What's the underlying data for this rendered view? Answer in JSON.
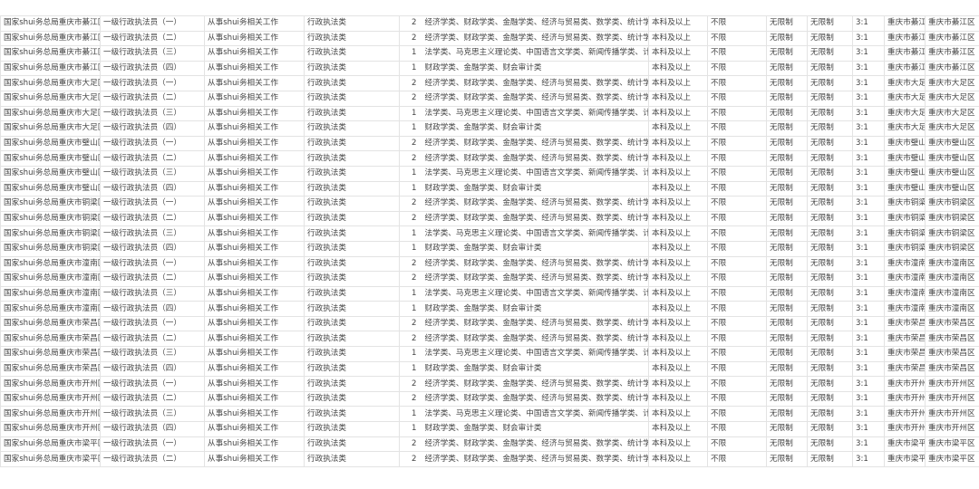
{
  "rows": [
    [
      "国家shui务总局重庆市綦江区税务局",
      "一级行政执法员（一）",
      "从事shui务相关工作",
      "行政执法类",
      "2",
      "经济学类、财政学类、金融学类、经济与贸易类、数学类、统计学类",
      "本科及以上",
      "不限",
      "无限制",
      "无限制",
      "3:1",
      "重庆市綦江区",
      "重庆市綦江区"
    ],
    [
      "国家shui务总局重庆市綦江区税务局",
      "一级行政执法员（二）",
      "从事shui务相关工作",
      "行政执法类",
      "2",
      "经济学类、财政学类、金融学类、经济与贸易类、数学类、统计学类",
      "本科及以上",
      "不限",
      "无限制",
      "无限制",
      "3:1",
      "重庆市綦江区",
      "重庆市綦江区"
    ],
    [
      "国家shui务总局重庆市綦江区税务局",
      "一级行政执法员（三）",
      "从事shui务相关工作",
      "行政执法类",
      "1",
      "法学类、马克思主义理论类、中国语言文学类、新闻传播学类、计算机类",
      "本科及以上",
      "不限",
      "无限制",
      "无限制",
      "3:1",
      "重庆市綦江区",
      "重庆市綦江区"
    ],
    [
      "国家shui务总局重庆市綦江区税务局",
      "一级行政执法员（四）",
      "从事shui务相关工作",
      "行政执法类",
      "1",
      "财政学类、金融学类、财会审计类",
      "本科及以上",
      "不限",
      "无限制",
      "无限制",
      "3:1",
      "重庆市綦江区",
      "重庆市綦江区"
    ],
    [
      "国家shui务总局重庆市大足区税务局",
      "一级行政执法员（一）",
      "从事shui务相关工作",
      "行政执法类",
      "2",
      "经济学类、财政学类、金融学类、经济与贸易类、数学类、统计学类",
      "本科及以上",
      "不限",
      "无限制",
      "无限制",
      "3:1",
      "重庆市大足区",
      "重庆市大足区"
    ],
    [
      "国家shui务总局重庆市大足区税务局",
      "一级行政执法员（二）",
      "从事shui务相关工作",
      "行政执法类",
      "2",
      "经济学类、财政学类、金融学类、经济与贸易类、数学类、统计学类",
      "本科及以上",
      "不限",
      "无限制",
      "无限制",
      "3:1",
      "重庆市大足区",
      "重庆市大足区"
    ],
    [
      "国家shui务总局重庆市大足区税务局",
      "一级行政执法员（三）",
      "从事shui务相关工作",
      "行政执法类",
      "1",
      "法学类、马克思主义理论类、中国语言文学类、新闻传播学类、计算机类",
      "本科及以上",
      "不限",
      "无限制",
      "无限制",
      "3:1",
      "重庆市大足区",
      "重庆市大足区"
    ],
    [
      "国家shui务总局重庆市大足区税务局",
      "一级行政执法员（四）",
      "从事shui务相关工作",
      "行政执法类",
      "1",
      "财政学类、金融学类、财会审计类",
      "本科及以上",
      "不限",
      "无限制",
      "无限制",
      "3:1",
      "重庆市大足区",
      "重庆市大足区"
    ],
    [
      "国家shui务总局重庆市璧山区税务局",
      "一级行政执法员（一）",
      "从事shui务相关工作",
      "行政执法类",
      "2",
      "经济学类、财政学类、金融学类、经济与贸易类、数学类、统计学类",
      "本科及以上",
      "不限",
      "无限制",
      "无限制",
      "3:1",
      "重庆市璧山区",
      "重庆市璧山区"
    ],
    [
      "国家shui务总局重庆市璧山区税务局",
      "一级行政执法员（二）",
      "从事shui务相关工作",
      "行政执法类",
      "2",
      "经济学类、财政学类、金融学类、经济与贸易类、数学类、统计学类",
      "本科及以上",
      "不限",
      "无限制",
      "无限制",
      "3:1",
      "重庆市璧山区",
      "重庆市璧山区"
    ],
    [
      "国家shui务总局重庆市璧山区税务局",
      "一级行政执法员（三）",
      "从事shui务相关工作",
      "行政执法类",
      "1",
      "法学类、马克思主义理论类、中国语言文学类、新闻传播学类、计算机类",
      "本科及以上",
      "不限",
      "无限制",
      "无限制",
      "3:1",
      "重庆市璧山区",
      "重庆市璧山区"
    ],
    [
      "国家shui务总局重庆市璧山区税务局",
      "一级行政执法员（四）",
      "从事shui务相关工作",
      "行政执法类",
      "1",
      "财政学类、金融学类、财会审计类",
      "本科及以上",
      "不限",
      "无限制",
      "无限制",
      "3:1",
      "重庆市璧山区",
      "重庆市璧山区"
    ],
    [
      "国家shui务总局重庆市铜梁区税务局",
      "一级行政执法员（一）",
      "从事shui务相关工作",
      "行政执法类",
      "2",
      "经济学类、财政学类、金融学类、经济与贸易类、数学类、统计学类",
      "本科及以上",
      "不限",
      "无限制",
      "无限制",
      "3:1",
      "重庆市铜梁区",
      "重庆市铜梁区"
    ],
    [
      "国家shui务总局重庆市铜梁区税务局",
      "一级行政执法员（二）",
      "从事shui务相关工作",
      "行政执法类",
      "2",
      "经济学类、财政学类、金融学类、经济与贸易类、数学类、统计学类",
      "本科及以上",
      "不限",
      "无限制",
      "无限制",
      "3:1",
      "重庆市铜梁区",
      "重庆市铜梁区"
    ],
    [
      "国家shui务总局重庆市铜梁区税务局",
      "一级行政执法员（三）",
      "从事shui务相关工作",
      "行政执法类",
      "1",
      "法学类、马克思主义理论类、中国语言文学类、新闻传播学类、计算机类",
      "本科及以上",
      "不限",
      "无限制",
      "无限制",
      "3:1",
      "重庆市铜梁区",
      "重庆市铜梁区"
    ],
    [
      "国家shui务总局重庆市铜梁区税务局",
      "一级行政执法员（四）",
      "从事shui务相关工作",
      "行政执法类",
      "1",
      "财政学类、金融学类、财会审计类",
      "本科及以上",
      "不限",
      "无限制",
      "无限制",
      "3:1",
      "重庆市铜梁区",
      "重庆市铜梁区"
    ],
    [
      "国家shui务总局重庆市潼南区税务局",
      "一级行政执法员（一）",
      "从事shui务相关工作",
      "行政执法类",
      "2",
      "经济学类、财政学类、金融学类、经济与贸易类、数学类、统计学类",
      "本科及以上",
      "不限",
      "无限制",
      "无限制",
      "3:1",
      "重庆市潼南区",
      "重庆市潼南区"
    ],
    [
      "国家shui务总局重庆市潼南区税务局",
      "一级行政执法员（二）",
      "从事shui务相关工作",
      "行政执法类",
      "2",
      "经济学类、财政学类、金融学类、经济与贸易类、数学类、统计学类",
      "本科及以上",
      "不限",
      "无限制",
      "无限制",
      "3:1",
      "重庆市潼南区",
      "重庆市潼南区"
    ],
    [
      "国家shui务总局重庆市潼南区税务局",
      "一级行政执法员（三）",
      "从事shui务相关工作",
      "行政执法类",
      "1",
      "法学类、马克思主义理论类、中国语言文学类、新闻传播学类、计算机类",
      "本科及以上",
      "不限",
      "无限制",
      "无限制",
      "3:1",
      "重庆市潼南区",
      "重庆市潼南区"
    ],
    [
      "国家shui务总局重庆市潼南区税务局",
      "一级行政执法员（四）",
      "从事shui务相关工作",
      "行政执法类",
      "1",
      "财政学类、金融学类、财会审计类",
      "本科及以上",
      "不限",
      "无限制",
      "无限制",
      "3:1",
      "重庆市潼南区",
      "重庆市潼南区"
    ],
    [
      "国家shui务总局重庆市荣昌区税务局",
      "一级行政执法员（一）",
      "从事shui务相关工作",
      "行政执法类",
      "2",
      "经济学类、财政学类、金融学类、经济与贸易类、数学类、统计学类",
      "本科及以上",
      "不限",
      "无限制",
      "无限制",
      "3:1",
      "重庆市荣昌区",
      "重庆市荣昌区"
    ],
    [
      "国家shui务总局重庆市荣昌区税务局",
      "一级行政执法员（二）",
      "从事shui务相关工作",
      "行政执法类",
      "2",
      "经济学类、财政学类、金融学类、经济与贸易类、数学类、统计学类",
      "本科及以上",
      "不限",
      "无限制",
      "无限制",
      "3:1",
      "重庆市荣昌区",
      "重庆市荣昌区"
    ],
    [
      "国家shui务总局重庆市荣昌区税务局",
      "一级行政执法员（三）",
      "从事shui务相关工作",
      "行政执法类",
      "1",
      "法学类、马克思主义理论类、中国语言文学类、新闻传播学类、计算机类",
      "本科及以上",
      "不限",
      "无限制",
      "无限制",
      "3:1",
      "重庆市荣昌区",
      "重庆市荣昌区"
    ],
    [
      "国家shui务总局重庆市荣昌区税务局",
      "一级行政执法员（四）",
      "从事shui务相关工作",
      "行政执法类",
      "1",
      "财政学类、金融学类、财会审计类",
      "本科及以上",
      "不限",
      "无限制",
      "无限制",
      "3:1",
      "重庆市荣昌区",
      "重庆市荣昌区"
    ],
    [
      "国家shui务总局重庆市开州区税务局",
      "一级行政执法员（一）",
      "从事shui务相关工作",
      "行政执法类",
      "2",
      "经济学类、财政学类、金融学类、经济与贸易类、数学类、统计学类",
      "本科及以上",
      "不限",
      "无限制",
      "无限制",
      "3:1",
      "重庆市开州区",
      "重庆市开州区"
    ],
    [
      "国家shui务总局重庆市开州区税务局",
      "一级行政执法员（二）",
      "从事shui务相关工作",
      "行政执法类",
      "2",
      "经济学类、财政学类、金融学类、经济与贸易类、数学类、统计学类",
      "本科及以上",
      "不限",
      "无限制",
      "无限制",
      "3:1",
      "重庆市开州区",
      "重庆市开州区"
    ],
    [
      "国家shui务总局重庆市开州区税务局",
      "一级行政执法员（三）",
      "从事shui务相关工作",
      "行政执法类",
      "1",
      "法学类、马克思主义理论类、中国语言文学类、新闻传播学类、计算机类",
      "本科及以上",
      "不限",
      "无限制",
      "无限制",
      "3:1",
      "重庆市开州区",
      "重庆市开州区"
    ],
    [
      "国家shui务总局重庆市开州区税务局",
      "一级行政执法员（四）",
      "从事shui务相关工作",
      "行政执法类",
      "1",
      "财政学类、金融学类、财会审计类",
      "本科及以上",
      "不限",
      "无限制",
      "无限制",
      "3:1",
      "重庆市开州区",
      "重庆市开州区"
    ],
    [
      "国家shui务总局重庆市梁平区税务局",
      "一级行政执法员（一）",
      "从事shui务相关工作",
      "行政执法类",
      "2",
      "经济学类、财政学类、金融学类、经济与贸易类、数学类、统计学类",
      "本科及以上",
      "不限",
      "无限制",
      "无限制",
      "3:1",
      "重庆市梁平区",
      "重庆市梁平区"
    ],
    [
      "国家shui务总局重庆市梁平区税务局",
      "一级行政执法员（二）",
      "从事shui务相关工作",
      "行政执法类",
      "2",
      "经济学类、财政学类、金融学类、经济与贸易类、数学类、统计学类",
      "本科及以上",
      "不限",
      "无限制",
      "无限制",
      "3:1",
      "重庆市梁平区",
      "重庆市梁平区"
    ]
  ]
}
